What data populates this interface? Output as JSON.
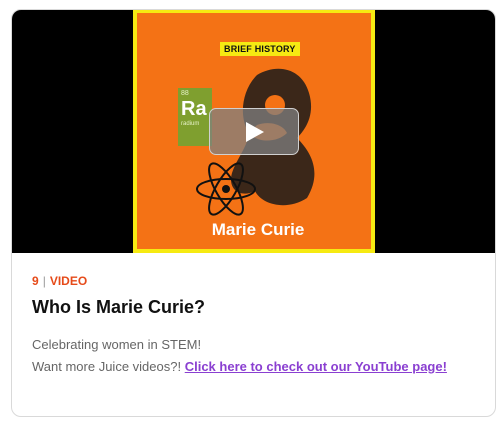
{
  "card": {
    "thumbnail": {
      "badge": "BRIEF HISTORY",
      "element": {
        "number": "88",
        "symbol": "Ra",
        "name": "radium"
      },
      "title": "Marie Curie"
    },
    "meta": {
      "number": "9",
      "type": "VIDEO"
    },
    "title": "Who Is Marie Curie?",
    "description_line1": "Celebrating women in STEM!",
    "description_line2": "Want more Juice videos?!",
    "link_text": "Click here to check out our YouTube page!"
  },
  "colors": {
    "accent_orange": "#f47215",
    "badge_yellow": "#f6ea12",
    "meta_red": "#e64a19",
    "link_purple": "#8a3fd1"
  },
  "icons": [
    "play-icon",
    "atom-icon"
  ]
}
